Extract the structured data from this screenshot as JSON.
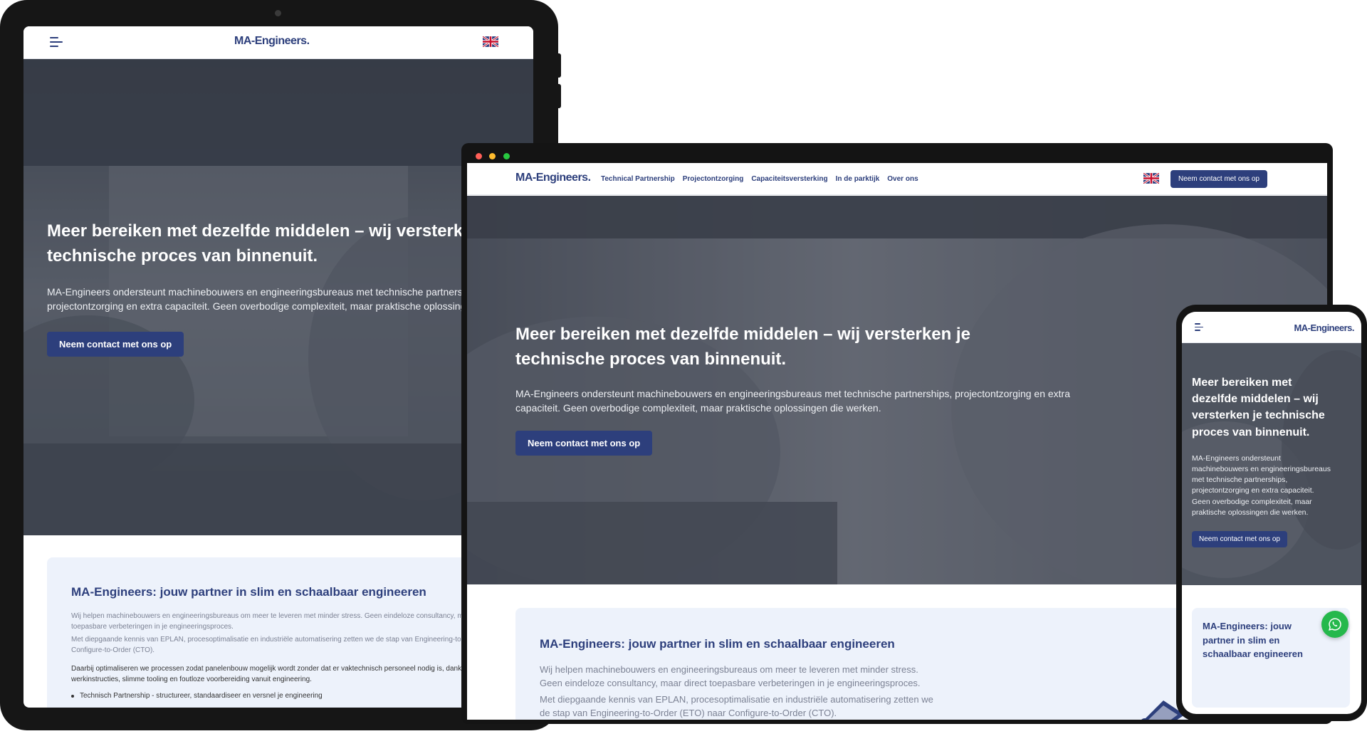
{
  "brand": {
    "logo_text": "MA-Engineers",
    "logo_dot": ".",
    "primary_color": "#2d3f7c",
    "card_bg": "#edf2fb"
  },
  "nav": {
    "items": [
      {
        "label": "Technical Partnership"
      },
      {
        "label": "Projectontzorging"
      },
      {
        "label": "Capaciteitsversterking"
      },
      {
        "label": "In de parktijk"
      },
      {
        "label": "Over ons"
      }
    ],
    "cta_label": "Neem contact met ons op",
    "language_icon": "uk-flag-icon"
  },
  "hero": {
    "heading": "Meer bereiken met dezelfde middelen – wij versterken je technische proces van binnenuit.",
    "subtext": "MA-Engineers ondersteunt machinebouwers en engineeringsbureaus met technische partnerships, projectontzorging en extra capaciteit. Geen overbodige complexiteit, maar praktische oplossingen die werken.",
    "button_label": "Neem contact met ons op"
  },
  "intro": {
    "heading": "MA-Engineers: jouw partner in slim en schaalbaar engineeren",
    "paragraph1": "Wij helpen machinebouwers en engineeringsbureaus om meer te leveren met minder stress. Geen eindeloze consultancy, maar direct toepasbare verbeteringen in je engineeringsproces.",
    "paragraph2": "Met diepgaande kennis van EPLAN, procesoptimalisatie en industriële automatisering zetten we de stap van Engineering-to-Order (ETO) naar Configure-to-Order (CTO).",
    "paragraph3": "Daarbij optimaliseren we processen zodat panelenbouw mogelijk wordt zonder dat er vaktechnisch personeel nodig is, dankzij digitale werkinstructies, slimme tooling en foutloze voorbereiding vanuit engineering.",
    "bullet1": "Technisch Partnership - structureer, standaardiseer en versnel je engineering"
  },
  "floating": {
    "whatsapp_icon": "whatsapp-icon"
  }
}
